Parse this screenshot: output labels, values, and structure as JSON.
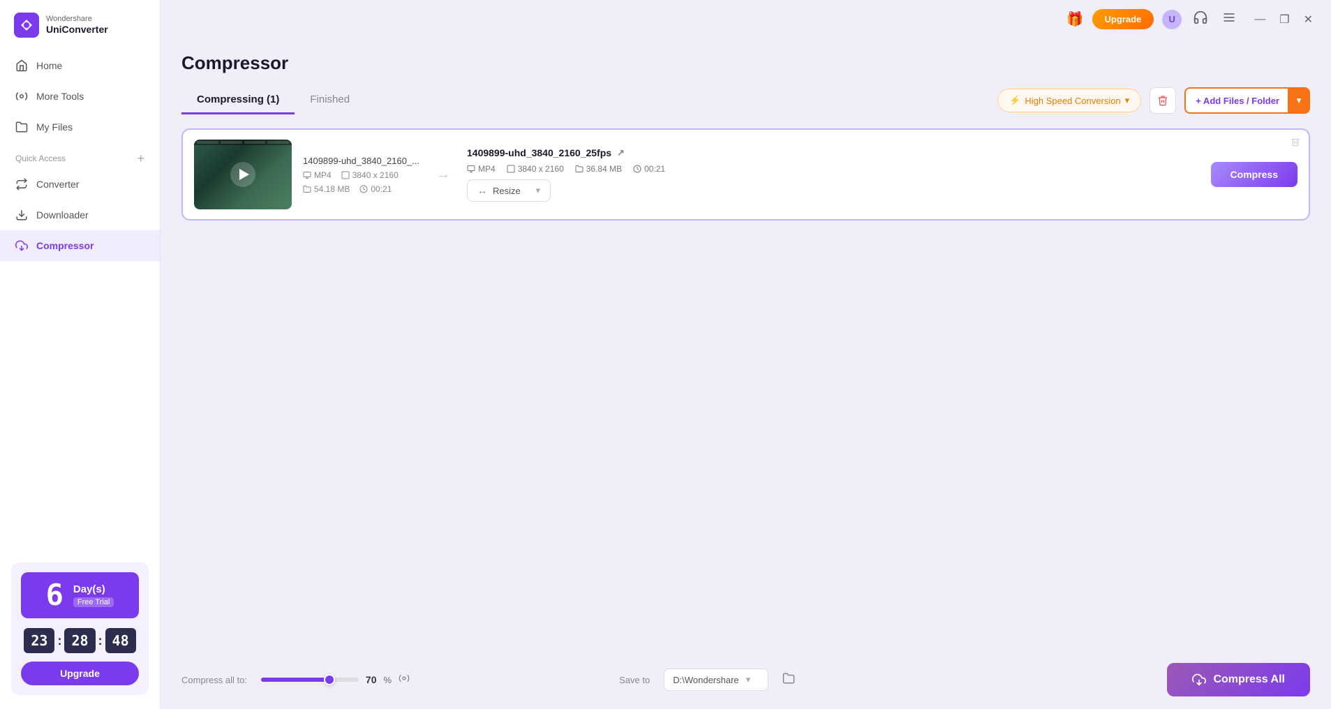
{
  "app": {
    "brand_top": "Wondershare",
    "brand_bottom": "UniConverter"
  },
  "sidebar": {
    "nav_items": [
      {
        "id": "home",
        "label": "Home"
      },
      {
        "id": "more-tools",
        "label": "More Tools"
      },
      {
        "id": "my-files",
        "label": "My Files"
      }
    ],
    "quick_access_label": "Quick Access",
    "quick_access_items": [
      {
        "id": "converter",
        "label": "Converter"
      },
      {
        "id": "downloader",
        "label": "Downloader"
      },
      {
        "id": "compressor",
        "label": "Compressor"
      }
    ],
    "trial": {
      "days_number": "6",
      "days_label": "Day(s)",
      "free_trial": "Free Trial",
      "timer_h": "23",
      "timer_m": "28",
      "timer_s": "48",
      "upgrade_label": "Upgrade"
    }
  },
  "topbar": {
    "upgrade_label": "Upgrade"
  },
  "page": {
    "title": "Compressor",
    "tabs": [
      {
        "id": "compressing",
        "label": "Compressing (1)",
        "active": true
      },
      {
        "id": "finished",
        "label": "Finished",
        "active": false
      }
    ],
    "high_speed_label": "High Speed Conversion",
    "delete_tooltip": "Delete",
    "add_files_label": "+ Add Files / Folder",
    "file_card": {
      "thumbnail_alt": "Video thumbnail",
      "file_name_left": "1409899-uhd_3840_2160_...",
      "format_left": "MP4",
      "size_left": "54.18 MB",
      "duration_left": "00:21",
      "resolution_left": "3840 x 2160",
      "file_name_right": "1409899-uhd_3840_2160_25fps",
      "format_right": "MP4",
      "size_right": "36.84 MB",
      "duration_right": "00:21",
      "resolution_right": "3840 x 2160",
      "resize_label": "Resize",
      "compress_label": "Compress"
    }
  },
  "bottom_bar": {
    "compress_all_to_label": "Compress all to:",
    "percent_value": "70",
    "percent_symbol": "%",
    "save_to_label": "Save to",
    "save_path": "D:\\Wondershare",
    "compress_all_label": "Compress All"
  },
  "icons": {
    "home": "⌂",
    "more_tools": "⚙",
    "my_files": "📁",
    "converter": "↔",
    "downloader": "⬇",
    "compressor": "📦",
    "lightning": "⚡",
    "play": "▶",
    "plus": "+",
    "chevron_down": "▾",
    "delete": "🗑",
    "gear": "⚙",
    "folder": "📂",
    "resize": "↔",
    "compress_all_icon": "📦"
  }
}
